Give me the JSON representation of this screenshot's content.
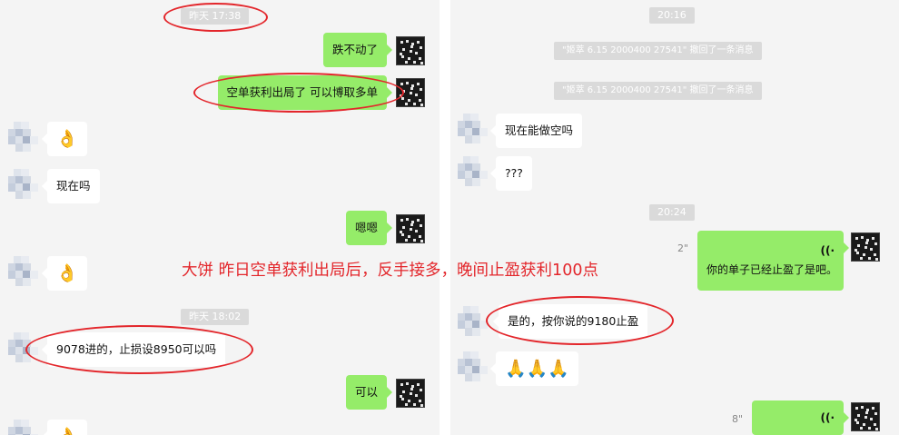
{
  "caption": "大饼 昨日空单获利出局后，反手接多，晚间止盈获利100点",
  "left_chat": {
    "timestamp_1": "昨天 17:38",
    "msg_1": "跌不动了",
    "msg_2": "空单获利出局了 可以博取多单",
    "msg_3": "👌",
    "msg_4": "现在吗",
    "msg_5": "嗯嗯",
    "msg_6": "👌",
    "timestamp_2": "昨天 18:02",
    "msg_7": "9078进的，止损设8950可以吗",
    "msg_8": "可以",
    "msg_9": "👌"
  },
  "right_chat": {
    "timestamp_1": "20:16",
    "system_1": "\"姬萃 6.15  2000400  27541\" 撤回了一条消息",
    "system_2": "\"姬萃 6.15  2000400  27541\" 撤回了一条消息",
    "msg_1": "现在能做空吗",
    "msg_2": "???",
    "timestamp_2": "20:24",
    "voice_1_duration": "2\"",
    "voice_1_transcript": "你的单子已经止盈了是吧。",
    "msg_3": "是的，按你说的9180止盈",
    "msg_4": "🙏🙏🙏",
    "voice_2_duration": "8\""
  },
  "icons": {
    "voice": "voice-wave-icon",
    "avatar_self": "qr-style-avatar",
    "avatar_other": "pixelated-avatar"
  },
  "colors": {
    "panel_bg": "#f4f4f4",
    "bubble_green": "#95ec69",
    "bubble_white": "#ffffff",
    "timestamp_bg": "#dadada",
    "annotation_red": "#e3262b"
  }
}
